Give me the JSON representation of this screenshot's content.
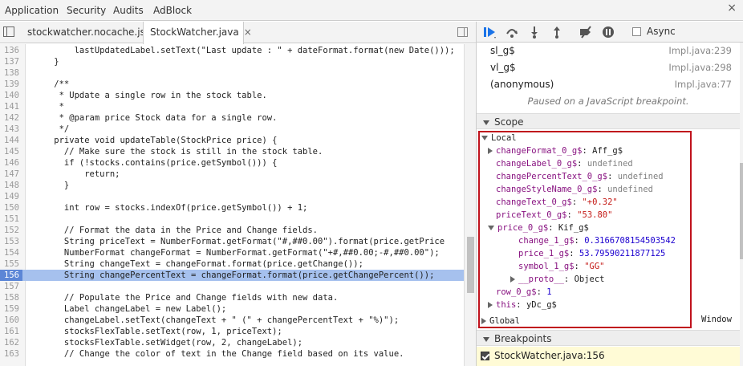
{
  "top_tabs": [
    "Application",
    "Security",
    "Audits",
    "AdBlock"
  ],
  "file_tabs": [
    {
      "label": "stockwatcher.nocache.js",
      "active": false
    },
    {
      "label": "StockWatcher.java",
      "active": true,
      "close": "×"
    }
  ],
  "close_glyph": "×",
  "editor": {
    "highlighted_line": "156",
    "lines": [
      {
        "num": "136",
        "text": "        lastUpdatedLabel.setText(\"Last update : \" + dateFormat.format(new Date()));"
      },
      {
        "num": "137",
        "text": "    }"
      },
      {
        "num": "138",
        "text": ""
      },
      {
        "num": "139",
        "text": "    /**"
      },
      {
        "num": "140",
        "text": "     * Update a single row in the stock table."
      },
      {
        "num": "141",
        "text": "     *"
      },
      {
        "num": "142",
        "text": "     * @param price Stock data for a single row."
      },
      {
        "num": "143",
        "text": "     */"
      },
      {
        "num": "144",
        "text": "    private void updateTable(StockPrice price) {"
      },
      {
        "num": "145",
        "text": "      // Make sure the stock is still in the stock table."
      },
      {
        "num": "146",
        "text": "      if (!stocks.contains(price.getSymbol())) {"
      },
      {
        "num": "147",
        "text": "          return;"
      },
      {
        "num": "148",
        "text": "      }"
      },
      {
        "num": "149",
        "text": ""
      },
      {
        "num": "150",
        "text": "      int row = stocks.indexOf(price.getSymbol()) + 1;"
      },
      {
        "num": "151",
        "text": ""
      },
      {
        "num": "152",
        "text": "      // Format the data in the Price and Change fields."
      },
      {
        "num": "153",
        "text": "      String priceText = NumberFormat.getFormat(\"#,##0.00\").format(price.getPrice"
      },
      {
        "num": "154",
        "text": "      NumberFormat changeFormat = NumberFormat.getFormat(\"+#,##0.00;-#,##0.00\");"
      },
      {
        "num": "155",
        "text": "      String changeText = changeFormat.format(price.getChange());"
      },
      {
        "num": "156",
        "text": "      String changePercentText = changeFormat.format(price.getChangePercent());"
      },
      {
        "num": "157",
        "text": ""
      },
      {
        "num": "158",
        "text": "      // Populate the Price and Change fields with new data."
      },
      {
        "num": "159",
        "text": "      Label changeLabel = new Label();"
      },
      {
        "num": "160",
        "text": "      changeLabel.setText(changeText + \" (\" + changePercentText + \"%)\");"
      },
      {
        "num": "161",
        "text": "      stocksFlexTable.setText(row, 1, priceText);"
      },
      {
        "num": "162",
        "text": "      stocksFlexTable.setWidget(row, 2, changeLabel);"
      },
      {
        "num": "163",
        "text": "      // Change the color of text in the Change field based on its value."
      }
    ]
  },
  "debugger": {
    "async_label": "Async",
    "call_stack": [
      {
        "fn": "sl_g$",
        "loc": "Impl.java:239"
      },
      {
        "fn": "vl_g$",
        "loc": "Impl.java:298"
      },
      {
        "fn": "(anonymous)",
        "loc": "Impl.java:77"
      }
    ],
    "paused_message": "Paused on a JavaScript breakpoint.",
    "scope_title": "Scope",
    "scope": {
      "local_label": "Local",
      "global_label": "Global",
      "global_value": "Window",
      "vars": [
        {
          "name": "changeFormat_0_g$",
          "value": "Aff_g$",
          "type": "plain",
          "expand": "right"
        },
        {
          "name": "changeLabel_0_g$",
          "value": "undefined",
          "type": "und"
        },
        {
          "name": "changePercentText_0_g$",
          "value": "undefined",
          "type": "und"
        },
        {
          "name": "changeStyleName_0_g$",
          "value": "undefined",
          "type": "und"
        },
        {
          "name": "changeText_0_g$",
          "value": "\"+0.32\"",
          "type": "str"
        },
        {
          "name": "priceText_0_g$",
          "value": "\"53.80\"",
          "type": "str"
        },
        {
          "name": "price_0_g$",
          "value": "Kif_g$",
          "type": "plain",
          "expand": "down"
        },
        {
          "name": "change_1_g$",
          "value": "0.3166708154503542",
          "type": "num",
          "indent": 2
        },
        {
          "name": "price_1_g$",
          "value": "53.79590211877125",
          "type": "num",
          "indent": 2
        },
        {
          "name": "symbol_1_g$",
          "value": "\"GG\"",
          "type": "str",
          "indent": 2
        },
        {
          "name": "__proto__",
          "value": "Object",
          "type": "plain",
          "indent": 2,
          "expand": "right"
        },
        {
          "name": "row_0_g$",
          "value": "1",
          "type": "num"
        },
        {
          "name": "this",
          "value": "yDc_g$",
          "type": "plain",
          "expand": "right"
        }
      ]
    },
    "breakpoints_title": "Breakpoints",
    "breakpoint": {
      "label": "StockWatcher.java:156",
      "checked": true
    }
  }
}
